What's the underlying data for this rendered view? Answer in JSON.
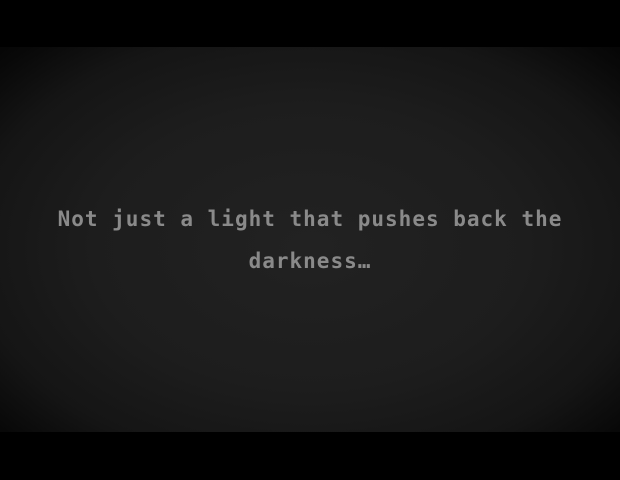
{
  "scene": {
    "dialogue_text": "Not just a light that pushes back the\ndarkness…"
  },
  "colors": {
    "background": "#000000",
    "vignette_center": "#222222",
    "text": "#8a8a8a"
  }
}
